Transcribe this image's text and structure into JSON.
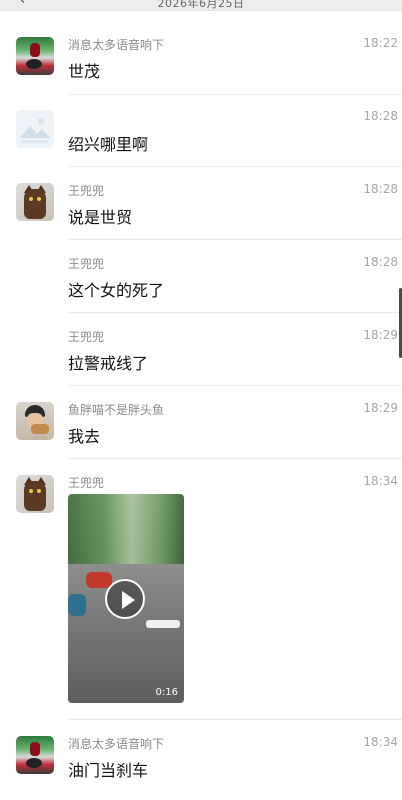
{
  "header": {
    "date": "2026年6月25日",
    "back_icon": "chevron-left-icon"
  },
  "messages": [
    {
      "name": "消息太多语音响下",
      "time": "18:22",
      "text": "世茂",
      "avatar": "scooter-avatar"
    },
    {
      "name": "",
      "time": "18:28",
      "text": "绍兴哪里啊",
      "avatar": "placeholder-avatar"
    },
    {
      "name": "王兜兜",
      "time": "18:28",
      "text": "说是世贸",
      "avatar": "cat-avatar"
    },
    {
      "name": "王兜兜",
      "time": "18:28",
      "text": "这个女的死了",
      "avatar": ""
    },
    {
      "name": "王兜兜",
      "time": "18:29",
      "text": "拉警戒线了",
      "avatar": ""
    },
    {
      "name": "鱼胖喵不是胖头鱼",
      "time": "18:29",
      "text": "我去",
      "avatar": "person-avatar"
    },
    {
      "name": "王兜兜",
      "time": "18:34",
      "text": "",
      "avatar": "cat-avatar",
      "video_duration": "0:16"
    },
    {
      "name": "消息太多语音响下",
      "time": "18:34",
      "text": "油门当刹车",
      "avatar": "scooter-avatar"
    }
  ]
}
